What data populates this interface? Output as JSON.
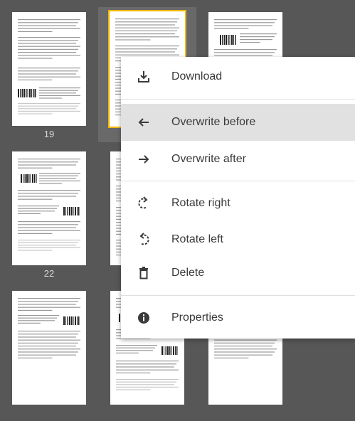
{
  "thumbnails": [
    {
      "number": "19",
      "selected": false
    },
    {
      "number": "",
      "selected": true
    },
    {
      "number": "",
      "selected": false
    },
    {
      "number": "22",
      "selected": false
    },
    {
      "number": "",
      "selected": false
    },
    {
      "number": "",
      "selected": false
    },
    {
      "number": "",
      "selected": false
    },
    {
      "number": "",
      "selected": false
    }
  ],
  "context_menu": {
    "items": [
      {
        "label": "Download",
        "icon": "download-icon"
      },
      {
        "label": "Overwrite before",
        "icon": "arrow-left-icon"
      },
      {
        "label": "Overwrite after",
        "icon": "arrow-right-icon"
      },
      {
        "label": "Rotate right",
        "icon": "rotate-right-icon"
      },
      {
        "label": "Rotate left",
        "icon": "rotate-left-icon"
      },
      {
        "label": "Delete",
        "icon": "trash-icon"
      },
      {
        "label": "Properties",
        "icon": "info-icon"
      }
    ]
  },
  "colors": {
    "background": "#575757",
    "selection_border": "#f2b600",
    "menu_highlight": "#e1e1e1"
  }
}
